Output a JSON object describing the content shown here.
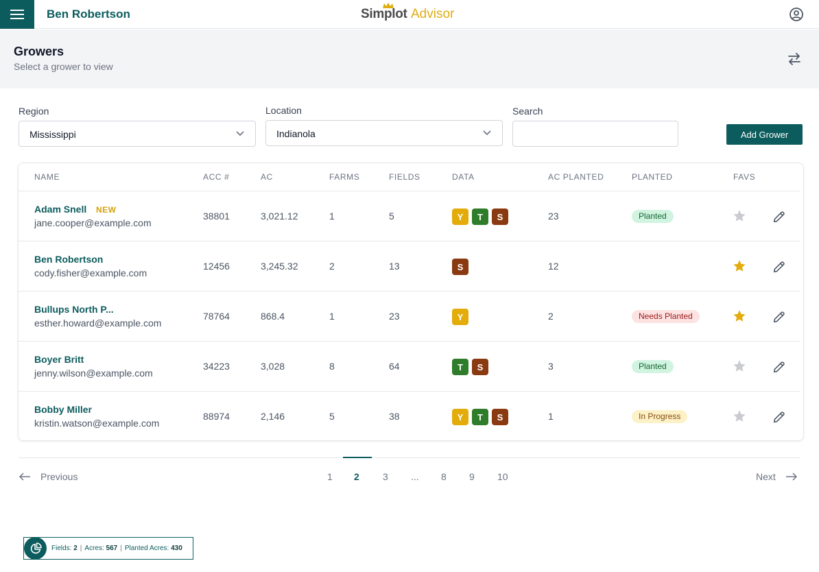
{
  "header": {
    "user_name": "Ben Robertson",
    "logo_brand": "Simplot",
    "logo_product": "Advisor"
  },
  "page": {
    "title": "Growers",
    "subtitle": "Select a grower to view"
  },
  "filters": {
    "region_label": "Region",
    "region_value": "Mississippi",
    "location_label": "Location",
    "location_value": "Indianola",
    "search_label": "Search",
    "search_value": "",
    "add_button": "Add Grower"
  },
  "table": {
    "columns": [
      "Name",
      "Acc #",
      "AC",
      "Farms",
      "Fields",
      "Data",
      "AC Planted",
      "Planted",
      "Favs"
    ],
    "rows": [
      {
        "name": "Adam Snell",
        "badge": "NEW",
        "email": "jane.cooper@example.com",
        "acc": "38801",
        "ac": "3,021.12",
        "farms": "1",
        "fields": "5",
        "data": [
          "Y",
          "T",
          "S"
        ],
        "ac_planted": "23",
        "planted": "Planted",
        "fav": false
      },
      {
        "name": "Ben Robertson",
        "badge": "",
        "email": "cody.fisher@example.com",
        "acc": "12456",
        "ac": "3,245.32",
        "farms": "2",
        "fields": "13",
        "data": [
          "S"
        ],
        "ac_planted": "12",
        "planted": "",
        "fav": true
      },
      {
        "name": "Bullups North P...",
        "badge": "",
        "email": "esther.howard@example.com",
        "acc": "78764",
        "ac": "868.4",
        "farms": "1",
        "fields": "23",
        "data": [
          "Y"
        ],
        "ac_planted": "2",
        "planted": "Needs Planted",
        "fav": true
      },
      {
        "name": "Boyer Britt",
        "badge": "",
        "email": "jenny.wilson@example.com",
        "acc": "34223",
        "ac": "3,028",
        "farms": "8",
        "fields": "64",
        "data": [
          "T",
          "S"
        ],
        "ac_planted": "3",
        "planted": "Planted",
        "fav": false
      },
      {
        "name": "Bobby Miller",
        "badge": "",
        "email": "kristin.watson@example.com",
        "acc": "88974",
        "ac": "2,146",
        "farms": "5",
        "fields": "38",
        "data": [
          "Y",
          "T",
          "S"
        ],
        "ac_planted": "1",
        "planted": "In Progress",
        "fav": false
      }
    ]
  },
  "pagination": {
    "previous": "Previous",
    "next": "Next",
    "pages": [
      "1",
      "2",
      "3",
      "...",
      "8",
      "9",
      "10"
    ],
    "current": "2"
  },
  "summary": {
    "fields_label": "Fields:",
    "fields_value": "2",
    "acres_label": "Acres:",
    "acres_value": "567",
    "planted_label": "Planted Acres:",
    "planted_value": "430"
  },
  "colors": {
    "brand": "#0c5c5e",
    "tag_Y": "#e3ac0b",
    "tag_T": "#2f7d2a",
    "tag_S": "#8a3a10",
    "star_on": "#e3ac0b",
    "star_off": "#c9cbcf"
  },
  "icons": {
    "menu": "hamburger-icon",
    "account": "user-circle-icon",
    "swap": "swap-arrows-icon",
    "chevron": "chevron-down-icon",
    "favorite": "star-icon",
    "edit": "pencil-icon",
    "prev": "arrow-left-icon",
    "next": "arrow-right-icon",
    "summary": "pie-chart-icon"
  }
}
